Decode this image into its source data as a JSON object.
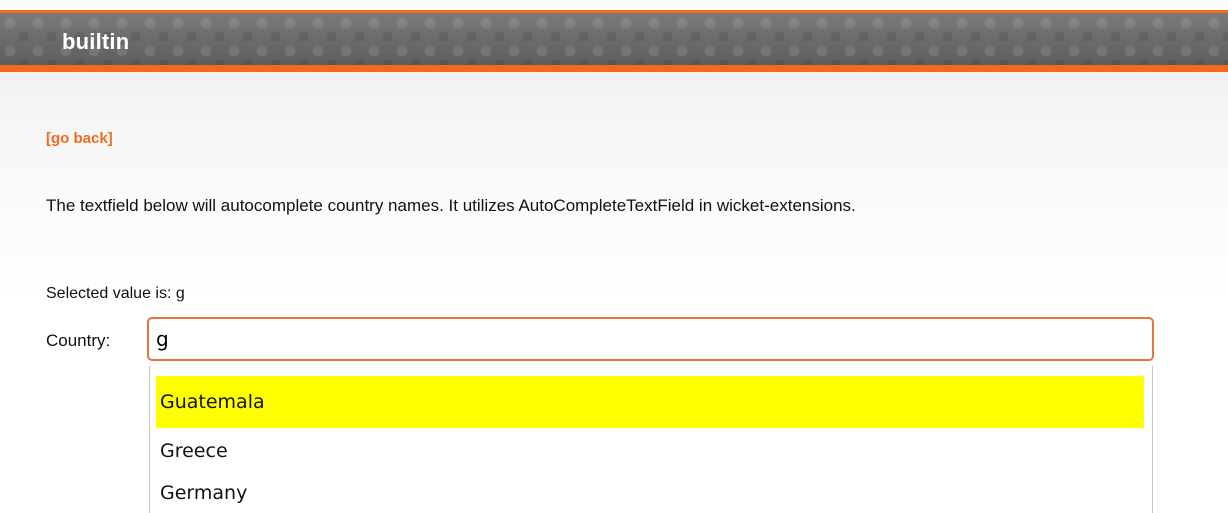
{
  "header": {
    "title": "builtin"
  },
  "back_link": "[go back]",
  "description": "The textfield below will autocomplete country names. It utilizes AutoCompleteTextField in wicket-extensions.",
  "selected": {
    "label": "Selected value is:",
    "value": "g"
  },
  "country": {
    "label": "Country:",
    "value": "g"
  },
  "suggestions": [
    "Guatemala",
    "Greece",
    "Germany"
  ],
  "colors": {
    "accent": "#f26a1b",
    "highlight": "#ffff00"
  }
}
